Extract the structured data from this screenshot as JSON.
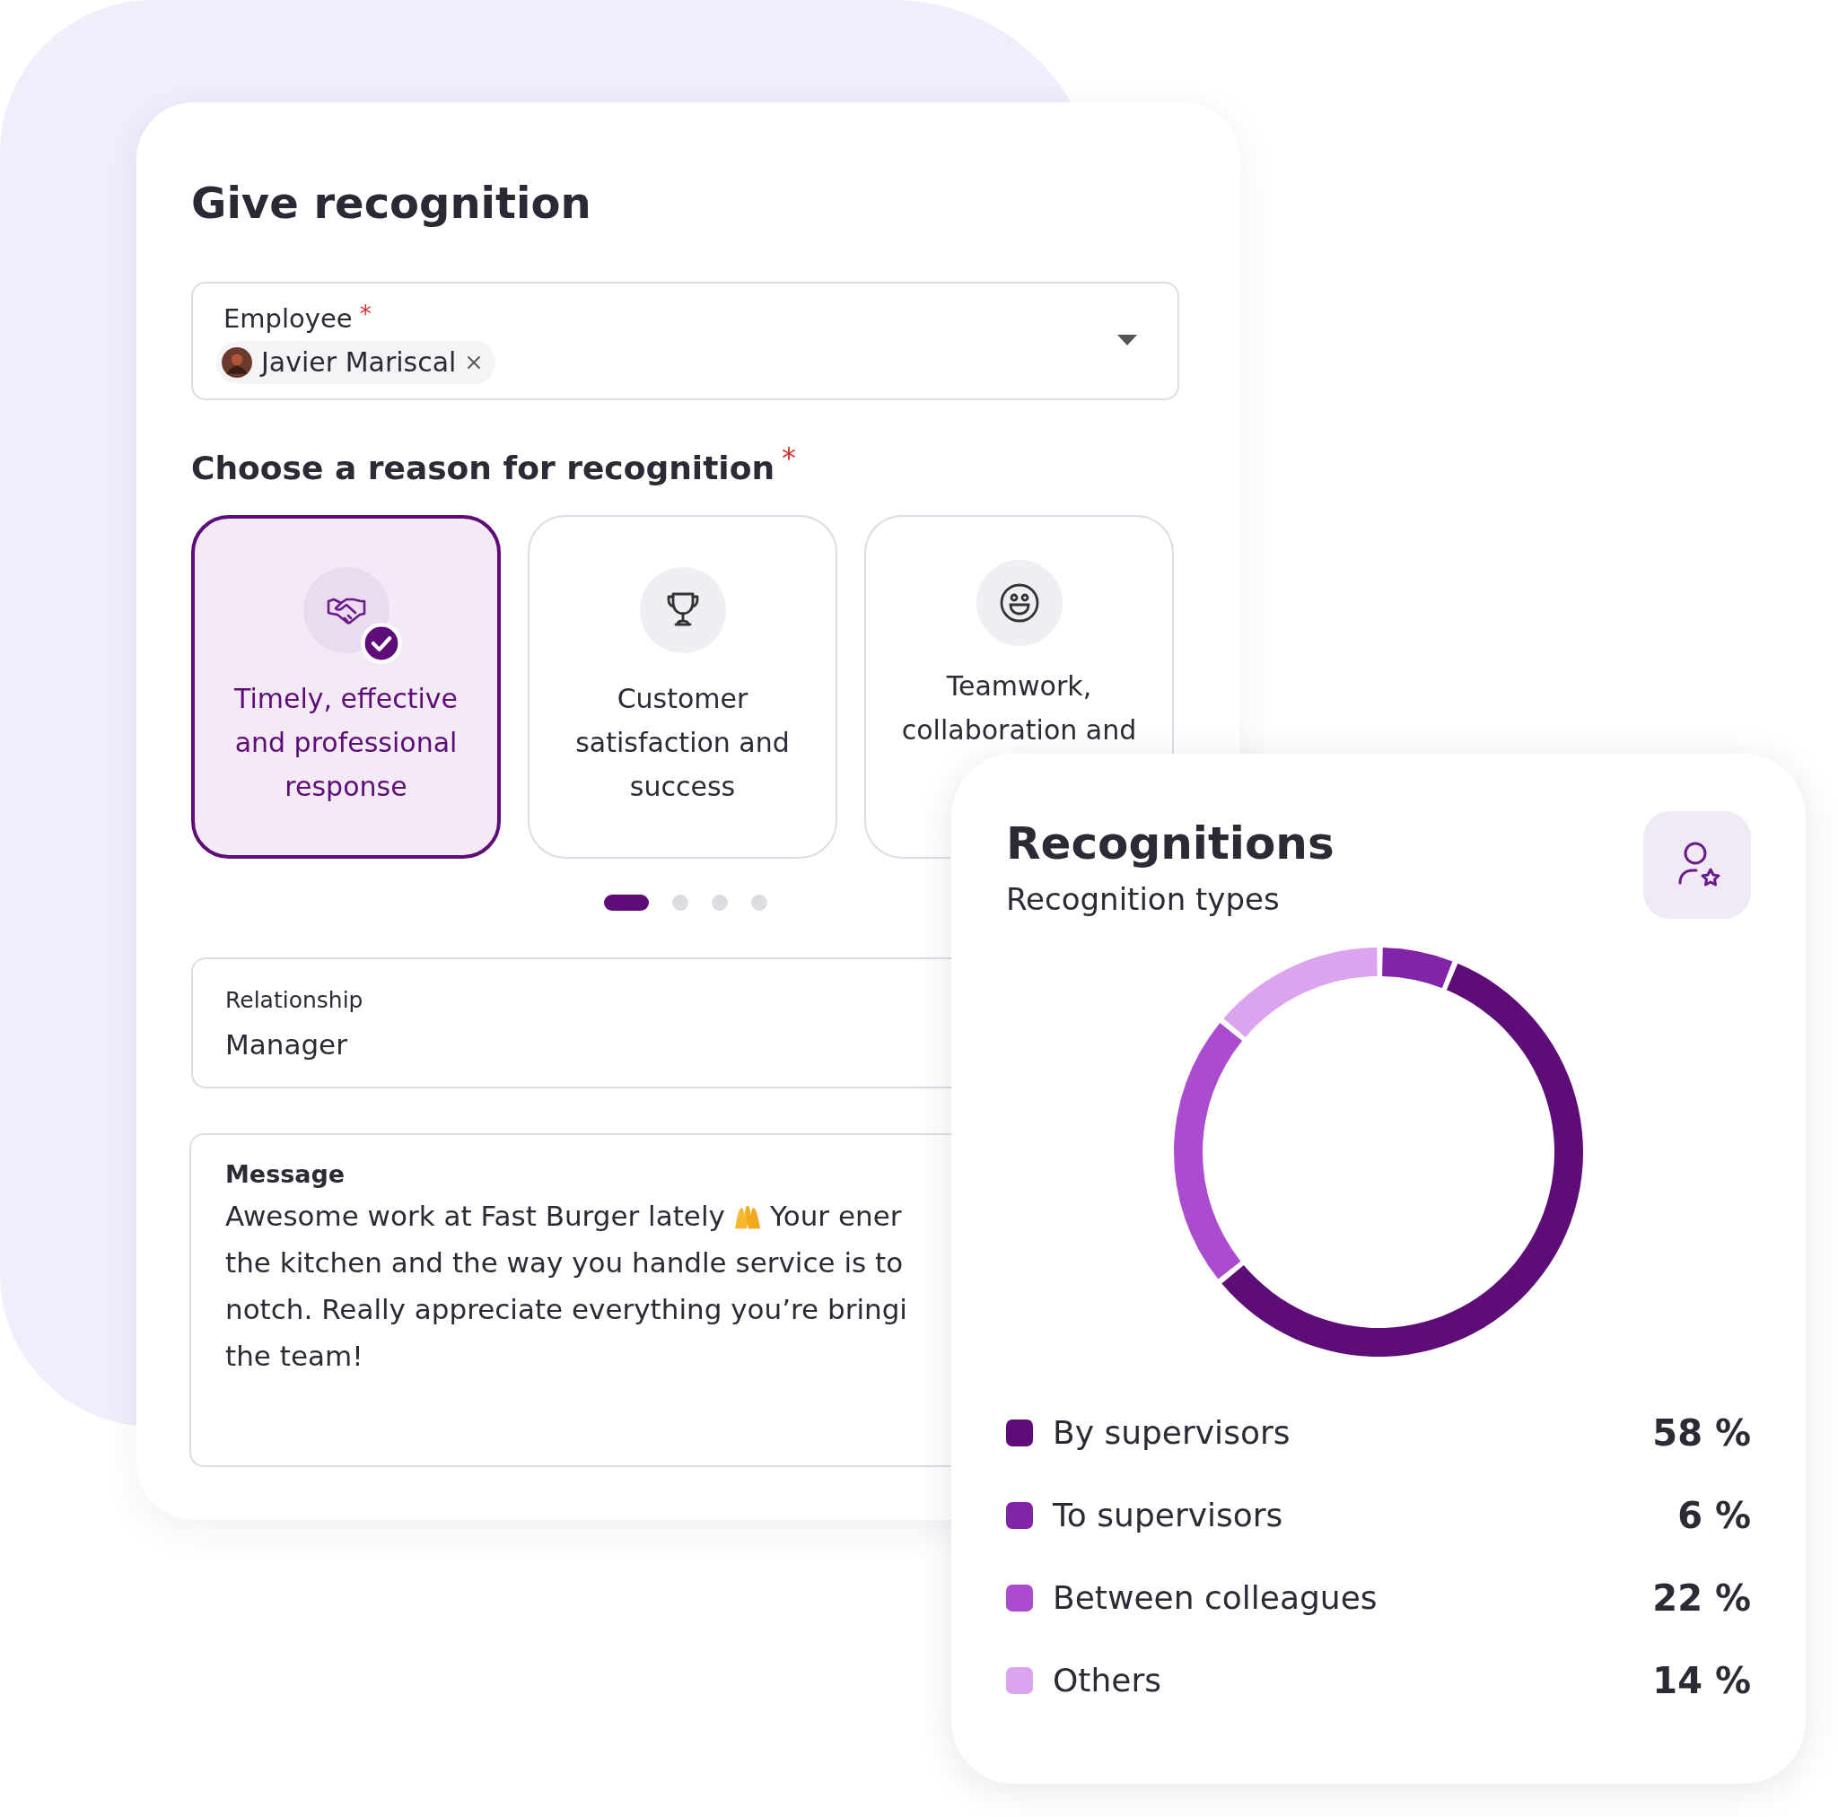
{
  "form": {
    "title": "Give recognition",
    "employee_field": {
      "label": "Employee",
      "required_mark": "*",
      "value": "Javier Mariscal"
    },
    "reason": {
      "label": "Choose a reason for recognition",
      "required_mark": "*",
      "options": [
        {
          "kind": "handshake",
          "label": "Timely, effective and professional response",
          "selected": true
        },
        {
          "kind": "trophy",
          "label": "Customer satisfaction and success",
          "selected": false
        },
        {
          "kind": "smile",
          "label": "Teamwork, collaboration and",
          "selected": false
        }
      ],
      "pages": [
        {
          "selected": true
        },
        {
          "selected": false
        },
        {
          "selected": false
        },
        {
          "selected": false
        }
      ]
    },
    "relationship_field": {
      "label": "Relationship",
      "value": "Manager"
    },
    "message_field": {
      "label": "Message",
      "lines": [
        {
          "parts": [
            "Awesome work at Fast Burger lately",
            "Your ener"
          ]
        },
        {
          "parts": [
            "the kitchen and the way you handle service is to"
          ]
        },
        {
          "parts": [
            "notch. Really appreciate everything you’re bringi"
          ]
        },
        {
          "parts": [
            "the team!"
          ]
        }
      ]
    }
  },
  "recognitions_card": {
    "title": "Recognitions",
    "chart_data": {
      "type": "donut",
      "categories": [
        "By supervisors",
        "To supervisors",
        "Between colleagues",
        "Others"
      ],
      "series": [
        {
          "name": "Recognition types",
          "values": [
            58,
            6,
            22,
            14
          ]
        }
      ]
    },
    "legend": [
      {
        "value": "58 %",
        "color": "#5e0c78"
      },
      {
        "value": "6 %",
        "color": "#8224a8"
      },
      {
        "value": "22 %",
        "color": "#ab4bd0"
      },
      {
        "value": "14 %",
        "color": "#dca4ee"
      }
    ]
  }
}
